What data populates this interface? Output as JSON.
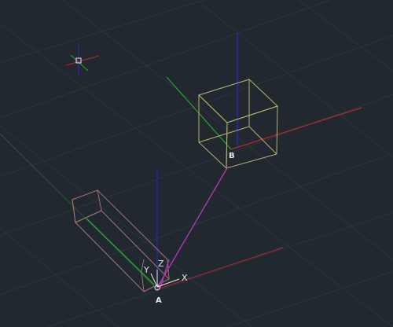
{
  "viewport": {
    "background": "#212830",
    "grid_color": "#2c343e"
  },
  "colors": {
    "x_axis": "#b52a2a",
    "y_axis": "#2aa52a",
    "z_axis": "#2a2ab5",
    "cube_b": "#b8b070",
    "box_a": "#a8706e",
    "segment_ab": "#b63ab6",
    "ucs_icon": "#e6e6e6"
  },
  "labels": {
    "point_a": "A",
    "point_b": "B",
    "ucs_x": "X",
    "ucs_y": "Y",
    "ucs_z": "Z"
  },
  "icons": {
    "crosshair": "crosshair-cursor-icon",
    "ucs": "ucs-icon"
  }
}
